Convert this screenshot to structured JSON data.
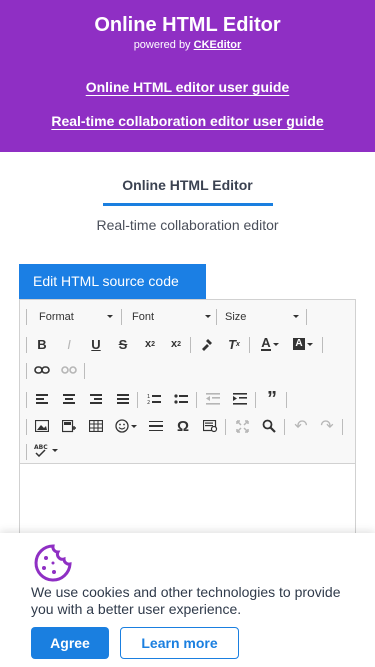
{
  "colors": {
    "header_bg": "#8f2fc4",
    "accent": "#1a7fe0",
    "cookie_icon": "#8f2fc4"
  },
  "header": {
    "title": "Online HTML Editor",
    "powered_prefix": "powered by",
    "powered_brand": "CKEditor",
    "link_user_guide": "Online HTML editor user guide",
    "link_collab_guide": "Real-time collaboration editor user guide"
  },
  "tabs": {
    "active": "Online HTML Editor",
    "secondary": "Real-time collaboration editor"
  },
  "editor": {
    "edit_source_label": "Edit HTML source code",
    "format_combo": "Format",
    "font_combo": "Font",
    "size_combo": "Size",
    "toolbar_icons": [
      "bold-icon",
      "italic-icon",
      "underline-icon",
      "strikethrough-icon",
      "subscript-icon",
      "superscript-icon",
      "copy-formatting-icon",
      "remove-format-icon",
      "text-color-icon",
      "background-color-icon",
      "link-icon",
      "unlink-icon",
      "align-left-icon",
      "align-center-icon",
      "align-right-icon",
      "justify-icon",
      "numbered-list-icon",
      "bulleted-list-icon",
      "decrease-indent-icon",
      "increase-indent-icon",
      "blockquote-icon",
      "image-icon",
      "insert-template-icon",
      "table-icon",
      "emoji-icon",
      "horizontal-line-icon",
      "special-char-icon",
      "preview-icon",
      "maximize-icon",
      "find-icon",
      "undo-icon",
      "redo-icon",
      "spellcheck-icon"
    ]
  },
  "cookie": {
    "icon": "cookie-icon",
    "message": "We use cookies and other technologies to provide you with a better user experience.",
    "agree_label": "Agree",
    "learn_more_label": "Learn more"
  }
}
